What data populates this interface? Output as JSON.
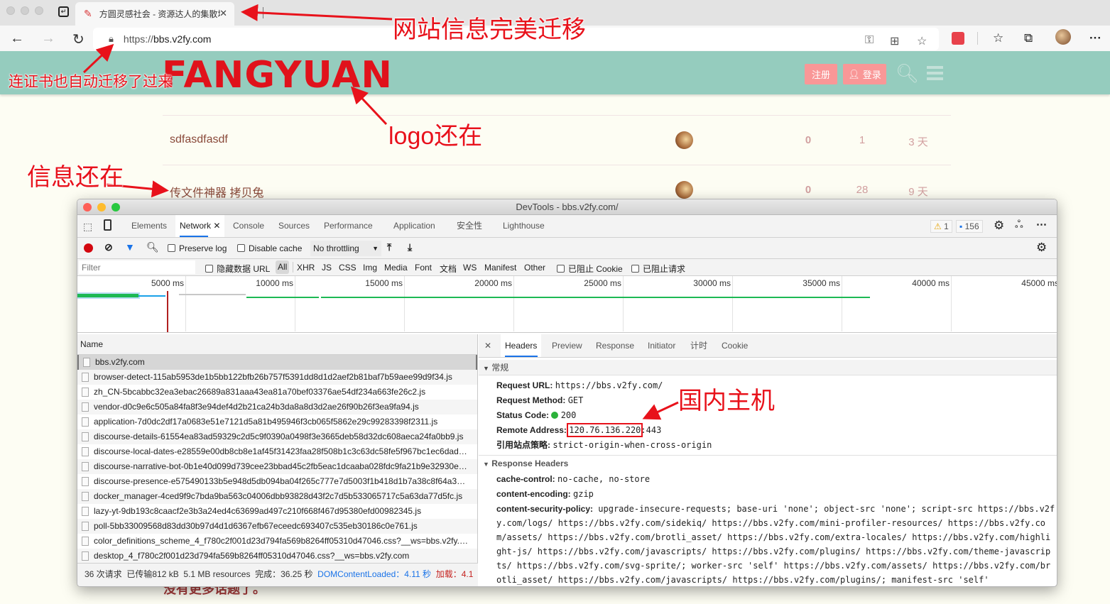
{
  "browser": {
    "tab_title": "方圆灵感社会 - 资源达人的集散地",
    "url_scheme": "https://",
    "url_host": "bbs.v2fy.com",
    "icons": [
      "back-icon",
      "forward-icon",
      "reload-icon",
      "lock-icon",
      "key-icon",
      "split-screen-icon",
      "add-favorite-icon",
      "extension-icon",
      "favorites-icon",
      "collections-icon",
      "profile-avatar",
      "more-icon"
    ]
  },
  "site": {
    "logo": "FANGYUAN",
    "register_label": "注册",
    "login_label": "登录",
    "topics": [
      {
        "title": "sdfasdfasdf",
        "replies": "0",
        "views": "1",
        "activity": "3 天"
      },
      {
        "title": "传文件神器 拷贝兔",
        "replies": "0",
        "views": "28",
        "activity": "9 天"
      }
    ],
    "footer_text": "没有更多话题了。"
  },
  "annotations": {
    "migrate": "网站信息完美迁移",
    "cert": "连证书也自动迁移了过来",
    "logo": "logo还在",
    "info": "信息还在",
    "host": "国内主机"
  },
  "devtools": {
    "title": "DevTools - bbs.v2fy.com/",
    "tabs": [
      "Elements",
      "Network",
      "Console",
      "Sources",
      "Performance",
      "Application",
      "安全性",
      "Lighthouse"
    ],
    "active_tab": "Network",
    "warnings": "1",
    "messages": "156",
    "toolbar": {
      "preserve_log": "Preserve log",
      "disable_cache": "Disable cache",
      "throttling": "No throttling"
    },
    "filter": {
      "placeholder": "Filter",
      "hide_data_urls": "隐藏数据 URL",
      "types": [
        "All",
        "XHR",
        "JS",
        "CSS",
        "Img",
        "Media",
        "Font",
        "文档",
        "WS",
        "Manifest",
        "Other"
      ],
      "blocked_cookies": "已阻止 Cookie",
      "blocked_requests": "已阻止请求"
    },
    "timeline_ticks": [
      "5000 ms",
      "10000 ms",
      "15000 ms",
      "20000 ms",
      "25000 ms",
      "30000 ms",
      "35000 ms",
      "40000 ms",
      "45000 ms"
    ],
    "name_header": "Name",
    "requests": [
      "bbs.v2fy.com",
      "browser-detect-115ab5953de1b5bb122bfb26b757f5391dd8d1d2aef2b81baf7b59aee99d9f34.js",
      "zh_CN-5bcabbc32ea3ebac26689a831aaa43ea81a70bef03376ae54df234a663fe26c2.js",
      "vendor-d0c9e6c505a84fa8f3e94def4d2b21ca24b3da8a8d3d2ae26f90b26f3ea9fa94.js",
      "application-7d0dc2df17a0683e51e7121d5a81b495946f3cb065f5862e29c99283398f2311.js",
      "discourse-details-61554ea83ad59329c2d5c9f0390a0498f3e3665deb58d32dc608aeca24fa0bb9.js",
      "discourse-local-dates-e28559e00db8cb8e1af45f31423faa28f508b1c3c63dc58fe5f967bc1ec6dad…",
      "discourse-narrative-bot-0b1e40d099d739cee23bbad45c2fb5eac1dcaaba028fdc9fa21b9e32930e…",
      "discourse-presence-e575490133b5e948d5db094ba04f265c777e7d5003f1b418d1b7a38c8f64a3…",
      "docker_manager-4ced9f9c7bda9ba563c04006dbb93828d43f2c7d5b533065717c5a63da77d5fc.js",
      "lazy-yt-9db193c8caacf2e3b3a24ed4c63699ad497c210f668f467d95380efd00982345.js",
      "poll-5bb33009568d83dd30b97d4d1d6367efb67eceedc693407c535eb30186c0e761.js",
      "color_definitions_scheme_4_f780c2f001d23d794fa569b8264ff05310d47046.css?__ws=bbs.v2fy.…",
      "desktop_4_f780c2f001d23d794fa569b8264ff05310d47046.css?__ws=bbs.v2fy.com"
    ],
    "status": {
      "requests": "36 次请求",
      "transferred": "已传输812 kB",
      "resources": "5.1 MB resources",
      "finish": "完成：36.25 秒",
      "dcl": "DOMContentLoaded：4.11 秒",
      "load": "加载：4.1"
    },
    "detail_tabs": [
      "Headers",
      "Preview",
      "Response",
      "Initiator",
      "计时",
      "Cookie"
    ],
    "general_section": "常规",
    "general": [
      {
        "key": "Request URL:",
        "value": "https://bbs.v2fy.com/"
      },
      {
        "key": "Request Method:",
        "value": "GET"
      },
      {
        "key": "Status Code:",
        "value": "200"
      },
      {
        "key": "Remote Address:",
        "value": "120.76.136.220",
        "port": ":443"
      },
      {
        "key": "引用站点策略:",
        "value": "strict-origin-when-cross-origin"
      }
    ],
    "response_section": "Response Headers",
    "response": [
      {
        "key": "cache-control:",
        "value": "no-cache, no-store"
      },
      {
        "key": "content-encoding:",
        "value": "gzip"
      },
      {
        "key": "content-security-policy:",
        "value": "upgrade-insecure-requests; base-uri 'none'; object-src 'none'; script-src https://bbs.v2fy.com/logs/ https://bbs.v2fy.com/sidekiq/ https://bbs.v2fy.com/mini-profiler-resources/ https://bbs.v2fy.com/assets/ https://bbs.v2fy.com/brotli_asset/ https://bbs.v2fy.com/extra-locales/ https://bbs.v2fy.com/highlight-js/ https://bbs.v2fy.com/javascripts/ https://bbs.v2fy.com/plugins/ https://bbs.v2fy.com/theme-javascripts/ https://bbs.v2fy.com/svg-sprite/; worker-src 'self' https://bbs.v2fy.com/assets/ https://bbs.v2fy.com/brotli_asset/ https://bbs.v2fy.com/javascripts/ https://bbs.v2fy.com/plugins/; manifest-src 'self'"
      }
    ]
  }
}
